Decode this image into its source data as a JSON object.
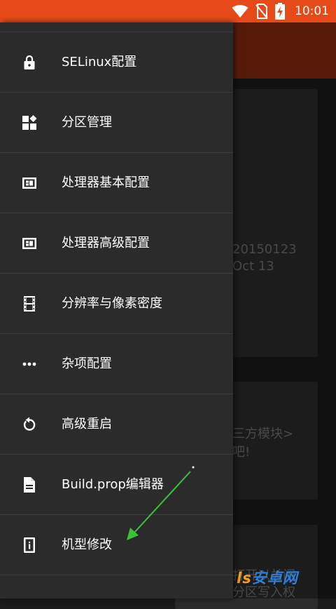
{
  "status_bar": {
    "time": "10:01",
    "icons": [
      "wifi-icon",
      "no-sim-icon",
      "battery-charging-icon"
    ],
    "color": "#e64a19"
  },
  "background_app": {
    "toolbar_color": "#86280e",
    "cards": [
      {
        "lines": [
          "20150123",
          "Oct 13"
        ]
      },
      {
        "lines": [
          "三方模块>",
          "吧!"
        ]
      },
      {
        "lines": [
          "打开以关闭",
          "分区写入权"
        ]
      }
    ],
    "watermark": {
      "num": "ls",
      "text": "安卓网"
    }
  },
  "drawer": {
    "items": [
      {
        "label": "SELinux配置",
        "icon": "lock-icon"
      },
      {
        "label": "分区管理",
        "icon": "widgets-icon"
      },
      {
        "label": "处理器基本配置",
        "icon": "processor-icon"
      },
      {
        "label": "处理器高级配置",
        "icon": "processor-icon"
      },
      {
        "label": "分辨率与像素密度",
        "icon": "film-strip-icon"
      },
      {
        "label": "杂项配置",
        "icon": "more-horizontal-icon"
      },
      {
        "label": "高级重启",
        "icon": "restart-icon"
      },
      {
        "label": "Build.prop编辑器",
        "icon": "document-icon"
      },
      {
        "label": "机型修改",
        "icon": "device-info-icon"
      }
    ]
  },
  "annotation": {
    "arrow_color": "#3cc23c"
  }
}
